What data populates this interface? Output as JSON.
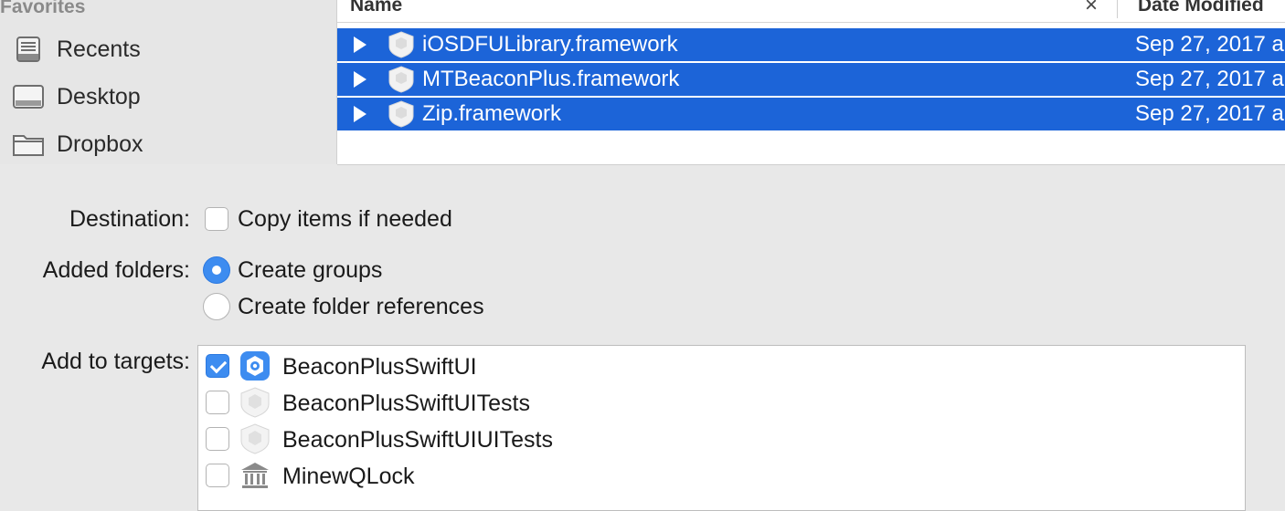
{
  "sidebar": {
    "section_title": "Favorites",
    "items": [
      {
        "label": "Recents",
        "icon": "recents-icon"
      },
      {
        "label": "Desktop",
        "icon": "desktop-icon"
      },
      {
        "label": "Dropbox",
        "icon": "folder-icon"
      }
    ]
  },
  "file_list": {
    "columns": {
      "name": "Name",
      "date_modified": "Date Modified"
    },
    "rows": [
      {
        "name": "iOSDFULibrary.framework",
        "date": "Sep 27, 2017 a",
        "selected": true
      },
      {
        "name": "MTBeaconPlus.framework",
        "date": "Sep 27, 2017 a",
        "selected": true
      },
      {
        "name": "Zip.framework",
        "date": "Sep 27, 2017 a",
        "selected": true
      }
    ],
    "selection_color": "#1c64d8"
  },
  "options": {
    "destination": {
      "label": "Destination:",
      "checkbox_label": "Copy items if needed",
      "checked": false
    },
    "added_folders": {
      "label": "Added folders:",
      "choices": [
        {
          "label": "Create groups",
          "selected": true
        },
        {
          "label": "Create folder references",
          "selected": false
        }
      ]
    },
    "add_to_targets": {
      "label": "Add to targets:",
      "targets": [
        {
          "name": "BeaconPlusSwiftUI",
          "checked": true,
          "icon": "app-target-icon"
        },
        {
          "name": "BeaconPlusSwiftUITests",
          "checked": false,
          "icon": "test-bundle-icon"
        },
        {
          "name": "BeaconPlusSwiftUIUITests",
          "checked": false,
          "icon": "test-bundle-icon"
        },
        {
          "name": "MinewQLock",
          "checked": false,
          "icon": "library-icon"
        }
      ]
    }
  },
  "accent_color": "#3d8cf0"
}
